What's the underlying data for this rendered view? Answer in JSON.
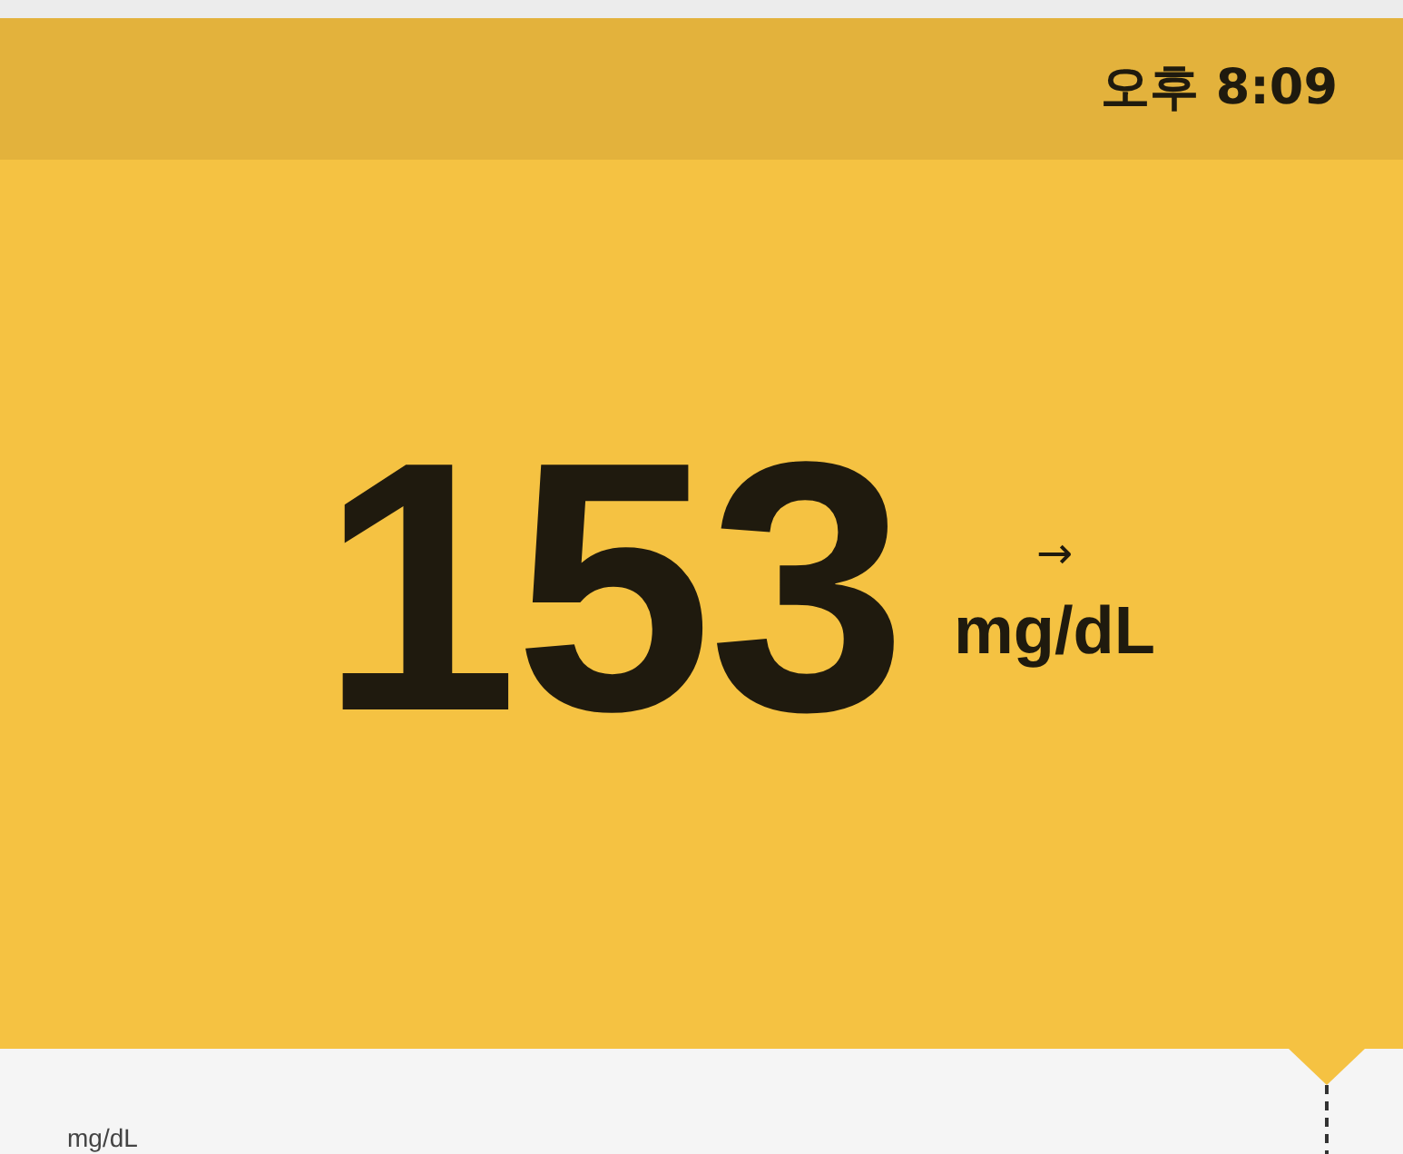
{
  "status_bar": {
    "time": "오후 8:09"
  },
  "reading": {
    "value": "153",
    "trend_arrow": "→",
    "unit": "mg/dL"
  },
  "chart": {
    "axis_unit": "mg/dL"
  }
}
